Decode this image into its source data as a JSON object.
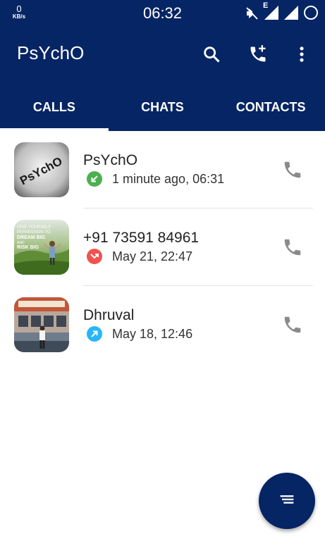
{
  "status_bar": {
    "net_speed": "0",
    "net_unit": "KB/s",
    "time": "06:32",
    "network_type": "E",
    "icons": [
      "mute-icon",
      "signal-icon",
      "signal-icon",
      "sync-icon"
    ]
  },
  "app_bar": {
    "title": "PsYchO",
    "actions": [
      "search-icon",
      "add-call-icon",
      "more-vert-icon"
    ]
  },
  "tabs": [
    {
      "label": "CALLS",
      "selected": true
    },
    {
      "label": "CHATS",
      "selected": false
    },
    {
      "label": "CONTACTS",
      "selected": false
    }
  ],
  "calls": [
    {
      "name": "PsYchO",
      "time": "1 minute ago, 06:31",
      "call_type": "incoming",
      "badge_color": "#4CAF50",
      "avatar_text": "PsYchO"
    },
    {
      "name": "+91 73591 84961",
      "time": "May 21, 22:47",
      "call_type": "missed",
      "badge_color": "#EF5350",
      "avatar_text": [
        "GIVE YOURSELF",
        "PERMISSION TO",
        "DREAM BIG",
        "AND",
        "RISK BIG"
      ]
    },
    {
      "name": "Dhruval",
      "time": "May 18, 12:46",
      "call_type": "outgoing",
      "badge_color": "#29B6F6",
      "avatar_text": ""
    }
  ],
  "fab": {
    "icon": "compose-icon"
  },
  "colors": {
    "primary": "#062564",
    "accent_white": "#FFFFFF",
    "icon_gray": "#8A8A8A"
  }
}
